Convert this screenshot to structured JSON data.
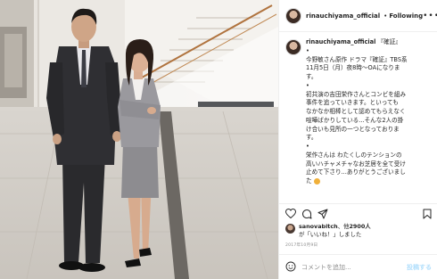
{
  "header": {
    "username": "rinauchiyama_official",
    "dot": "•",
    "follow_label": "Following",
    "more": "•••"
  },
  "caption": {
    "username": "rinauchiyama_official",
    "lines": [
      "『確証』",
      "•",
      "今野敏さん原作 ドラマ『確証』TBS系",
      "11月5日（月）夜8時〜OAになりま",
      "す。",
      "•",
      "初共演の吉田栄作さんとコンビを組み",
      "事件を追っていきます。といっても",
      "なかなか相棒として認めてもらえなく",
      "喧嘩ばかりしている...そんな2人の掛",
      "け合いも見所の一つとなっておりま",
      "す。",
      "•",
      "栄作さんは わたくしのテンションの",
      "高いハチャメチャなお芝居を全て受け",
      "止めて下さり...ありがとうございまし",
      "た"
    ]
  },
  "likes": {
    "liker": "sanovabitch",
    "middle": "、他",
    "count": "2900人",
    "suffix": "が「いいね！」しました"
  },
  "date": "2017年10月9日",
  "comment_box": {
    "placeholder": "コメントを追加...",
    "post_label": "投稿する"
  },
  "colors": {
    "verified": "#3897f0",
    "text": "#262626",
    "muted": "#8e8e8e",
    "border": "#efefef"
  },
  "icons": [
    "heart-icon",
    "comment-icon",
    "share-icon",
    "bookmark-icon",
    "smiley-icon",
    "verified-icon"
  ]
}
